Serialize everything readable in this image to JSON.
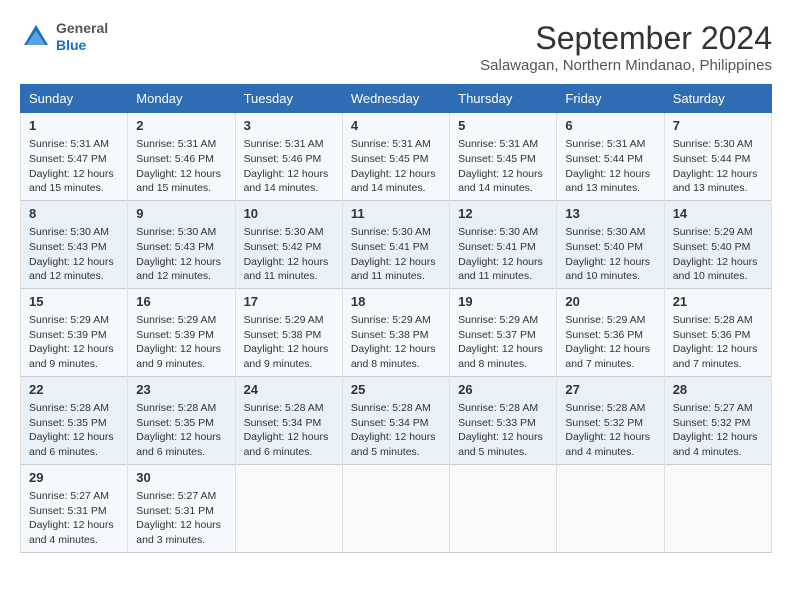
{
  "header": {
    "logo_general": "General",
    "logo_blue": "Blue",
    "month_title": "September 2024",
    "subtitle": "Salawagan, Northern Mindanao, Philippines"
  },
  "calendar": {
    "days_of_week": [
      "Sunday",
      "Monday",
      "Tuesday",
      "Wednesday",
      "Thursday",
      "Friday",
      "Saturday"
    ],
    "weeks": [
      [
        {
          "day": "",
          "content": ""
        },
        {
          "day": "",
          "content": ""
        },
        {
          "day": "",
          "content": ""
        },
        {
          "day": "",
          "content": ""
        },
        {
          "day": "",
          "content": ""
        },
        {
          "day": "",
          "content": ""
        },
        {
          "day": "",
          "content": ""
        }
      ]
    ]
  },
  "cells": {
    "w1": [
      {
        "day": "1",
        "rise": "Sunrise: 5:31 AM",
        "set": "Sunset: 5:47 PM",
        "daylight": "Daylight: 12 hours and 15 minutes."
      },
      {
        "day": "2",
        "rise": "Sunrise: 5:31 AM",
        "set": "Sunset: 5:46 PM",
        "daylight": "Daylight: 12 hours and 15 minutes."
      },
      {
        "day": "3",
        "rise": "Sunrise: 5:31 AM",
        "set": "Sunset: 5:46 PM",
        "daylight": "Daylight: 12 hours and 14 minutes."
      },
      {
        "day": "4",
        "rise": "Sunrise: 5:31 AM",
        "set": "Sunset: 5:45 PM",
        "daylight": "Daylight: 12 hours and 14 minutes."
      },
      {
        "day": "5",
        "rise": "Sunrise: 5:31 AM",
        "set": "Sunset: 5:45 PM",
        "daylight": "Daylight: 12 hours and 14 minutes."
      },
      {
        "day": "6",
        "rise": "Sunrise: 5:31 AM",
        "set": "Sunset: 5:44 PM",
        "daylight": "Daylight: 12 hours and 13 minutes."
      },
      {
        "day": "7",
        "rise": "Sunrise: 5:30 AM",
        "set": "Sunset: 5:44 PM",
        "daylight": "Daylight: 12 hours and 13 minutes."
      }
    ],
    "w2": [
      {
        "day": "8",
        "rise": "Sunrise: 5:30 AM",
        "set": "Sunset: 5:43 PM",
        "daylight": "Daylight: 12 hours and 12 minutes."
      },
      {
        "day": "9",
        "rise": "Sunrise: 5:30 AM",
        "set": "Sunset: 5:43 PM",
        "daylight": "Daylight: 12 hours and 12 minutes."
      },
      {
        "day": "10",
        "rise": "Sunrise: 5:30 AM",
        "set": "Sunset: 5:42 PM",
        "daylight": "Daylight: 12 hours and 11 minutes."
      },
      {
        "day": "11",
        "rise": "Sunrise: 5:30 AM",
        "set": "Sunset: 5:41 PM",
        "daylight": "Daylight: 12 hours and 11 minutes."
      },
      {
        "day": "12",
        "rise": "Sunrise: 5:30 AM",
        "set": "Sunset: 5:41 PM",
        "daylight": "Daylight: 12 hours and 11 minutes."
      },
      {
        "day": "13",
        "rise": "Sunrise: 5:30 AM",
        "set": "Sunset: 5:40 PM",
        "daylight": "Daylight: 12 hours and 10 minutes."
      },
      {
        "day": "14",
        "rise": "Sunrise: 5:29 AM",
        "set": "Sunset: 5:40 PM",
        "daylight": "Daylight: 12 hours and 10 minutes."
      }
    ],
    "w3": [
      {
        "day": "15",
        "rise": "Sunrise: 5:29 AM",
        "set": "Sunset: 5:39 PM",
        "daylight": "Daylight: 12 hours and 9 minutes."
      },
      {
        "day": "16",
        "rise": "Sunrise: 5:29 AM",
        "set": "Sunset: 5:39 PM",
        "daylight": "Daylight: 12 hours and 9 minutes."
      },
      {
        "day": "17",
        "rise": "Sunrise: 5:29 AM",
        "set": "Sunset: 5:38 PM",
        "daylight": "Daylight: 12 hours and 9 minutes."
      },
      {
        "day": "18",
        "rise": "Sunrise: 5:29 AM",
        "set": "Sunset: 5:38 PM",
        "daylight": "Daylight: 12 hours and 8 minutes."
      },
      {
        "day": "19",
        "rise": "Sunrise: 5:29 AM",
        "set": "Sunset: 5:37 PM",
        "daylight": "Daylight: 12 hours and 8 minutes."
      },
      {
        "day": "20",
        "rise": "Sunrise: 5:29 AM",
        "set": "Sunset: 5:36 PM",
        "daylight": "Daylight: 12 hours and 7 minutes."
      },
      {
        "day": "21",
        "rise": "Sunrise: 5:28 AM",
        "set": "Sunset: 5:36 PM",
        "daylight": "Daylight: 12 hours and 7 minutes."
      }
    ],
    "w4": [
      {
        "day": "22",
        "rise": "Sunrise: 5:28 AM",
        "set": "Sunset: 5:35 PM",
        "daylight": "Daylight: 12 hours and 6 minutes."
      },
      {
        "day": "23",
        "rise": "Sunrise: 5:28 AM",
        "set": "Sunset: 5:35 PM",
        "daylight": "Daylight: 12 hours and 6 minutes."
      },
      {
        "day": "24",
        "rise": "Sunrise: 5:28 AM",
        "set": "Sunset: 5:34 PM",
        "daylight": "Daylight: 12 hours and 6 minutes."
      },
      {
        "day": "25",
        "rise": "Sunrise: 5:28 AM",
        "set": "Sunset: 5:34 PM",
        "daylight": "Daylight: 12 hours and 5 minutes."
      },
      {
        "day": "26",
        "rise": "Sunrise: 5:28 AM",
        "set": "Sunset: 5:33 PM",
        "daylight": "Daylight: 12 hours and 5 minutes."
      },
      {
        "day": "27",
        "rise": "Sunrise: 5:28 AM",
        "set": "Sunset: 5:32 PM",
        "daylight": "Daylight: 12 hours and 4 minutes."
      },
      {
        "day": "28",
        "rise": "Sunrise: 5:27 AM",
        "set": "Sunset: 5:32 PM",
        "daylight": "Daylight: 12 hours and 4 minutes."
      }
    ],
    "w5": [
      {
        "day": "29",
        "rise": "Sunrise: 5:27 AM",
        "set": "Sunset: 5:31 PM",
        "daylight": "Daylight: 12 hours and 4 minutes."
      },
      {
        "day": "30",
        "rise": "Sunrise: 5:27 AM",
        "set": "Sunset: 5:31 PM",
        "daylight": "Daylight: 12 hours and 3 minutes."
      },
      {
        "day": "",
        "rise": "",
        "set": "",
        "daylight": ""
      },
      {
        "day": "",
        "rise": "",
        "set": "",
        "daylight": ""
      },
      {
        "day": "",
        "rise": "",
        "set": "",
        "daylight": ""
      },
      {
        "day": "",
        "rise": "",
        "set": "",
        "daylight": ""
      },
      {
        "day": "",
        "rise": "",
        "set": "",
        "daylight": ""
      }
    ]
  }
}
